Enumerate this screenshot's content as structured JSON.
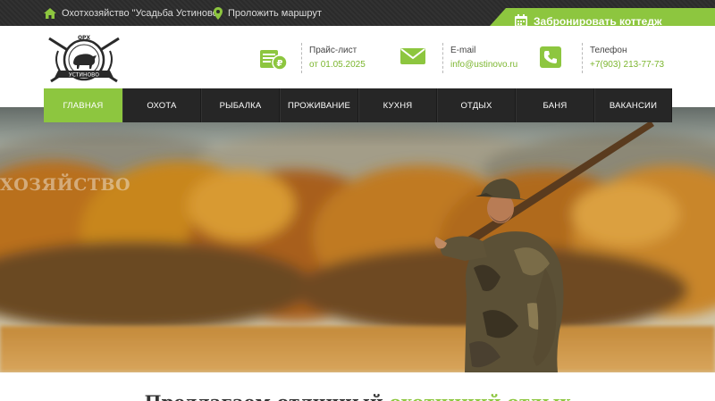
{
  "topbar": {
    "home_label": "Охотхозяйство \"Усадьба Устиново\"",
    "route_label": "Проложить маршрут",
    "book_label": "Забронировать коттедж"
  },
  "logo": {
    "text_top": "ОРХ",
    "text_bottom": "УСТИНОВО"
  },
  "contacts": {
    "price": {
      "label": "Прайс-лист",
      "value": "от 01.05.2025"
    },
    "email": {
      "label": "E-mail",
      "value": "info@ustinovo.ru"
    },
    "phone": {
      "label": "Телефон",
      "value": "+7(903) 213-77-73"
    }
  },
  "nav": {
    "items": [
      {
        "label": "ГЛАВНАЯ",
        "active": true
      },
      {
        "label": "ОХОТА"
      },
      {
        "label": "РЫБАЛКА"
      },
      {
        "label": "ПРОЖИВАНИЕ"
      },
      {
        "label": "КУХНЯ"
      },
      {
        "label": "ОТДЫХ"
      },
      {
        "label": "БАНЯ"
      },
      {
        "label": "ВАКАНСИИ"
      }
    ]
  },
  "hero": {
    "subtitle": "ХОЗЯЙСТВО"
  },
  "main": {
    "heading_prefix": "Предлагаем отличный",
    "heading_highlight": "охотничий отдых"
  },
  "colors": {
    "accent": "#8dc63f",
    "dark": "#262626",
    "topbar": "#2b2b2b"
  },
  "icons": {
    "home": "home-icon",
    "route": "map-pin-icon",
    "book": "calendar-icon",
    "price": "price-list-icon",
    "email": "envelope-icon",
    "phone": "phone-icon"
  }
}
